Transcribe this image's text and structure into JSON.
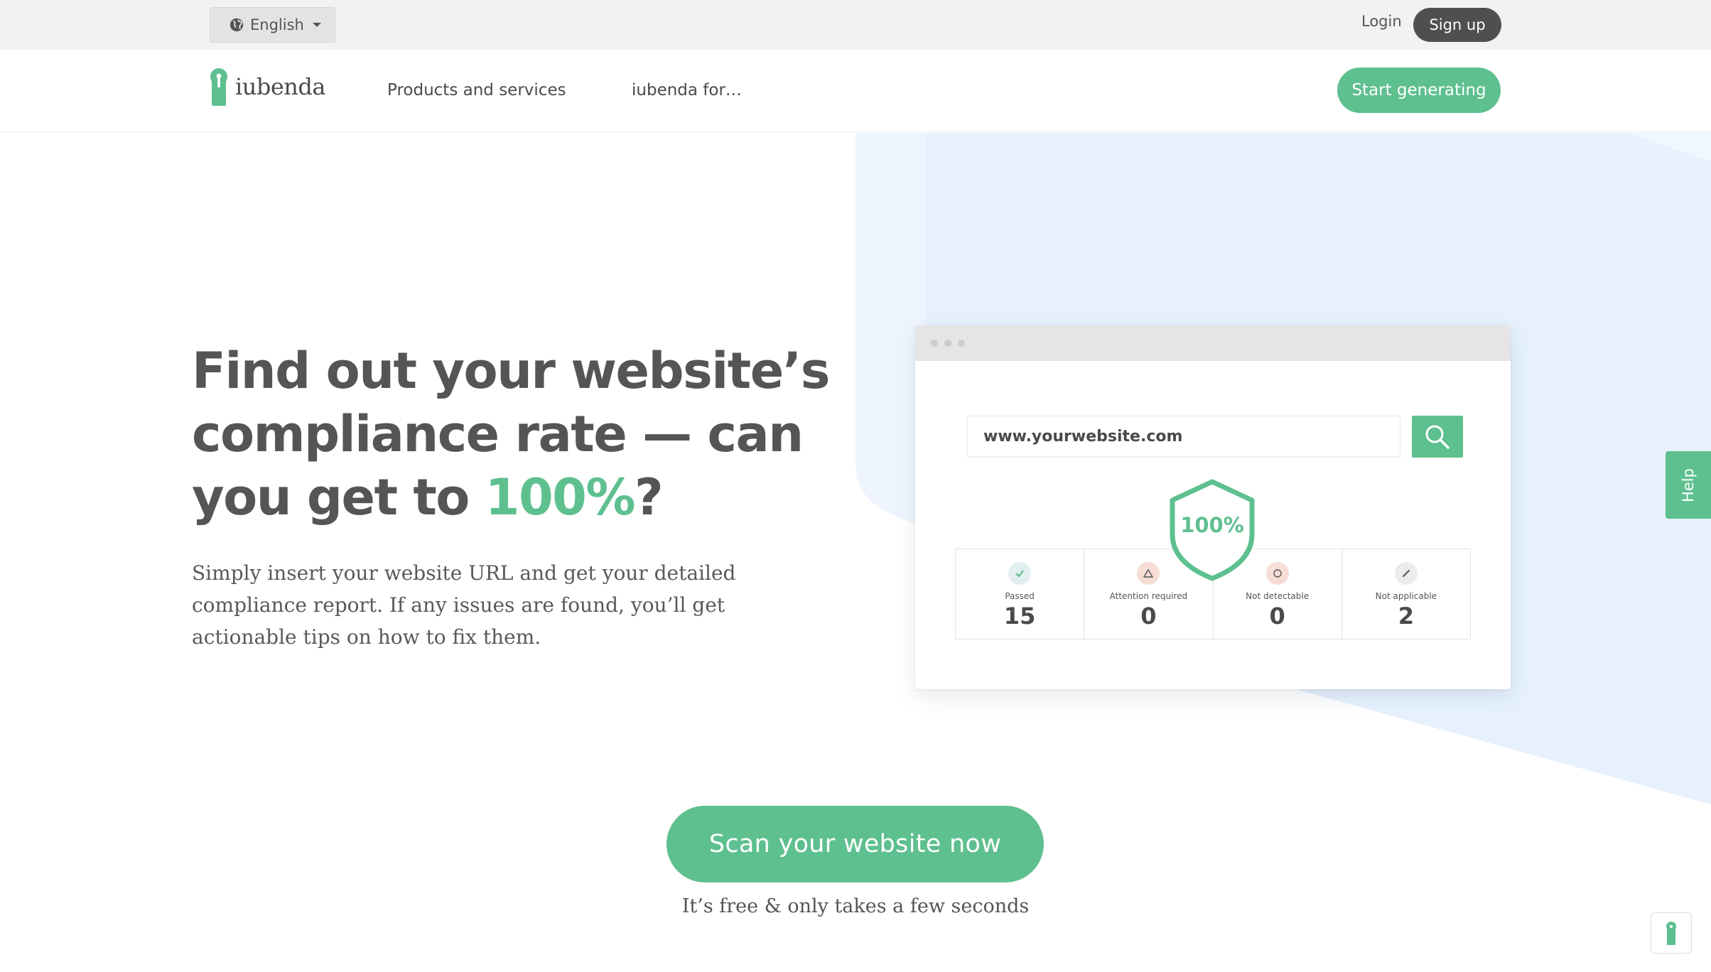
{
  "topbar": {
    "language": "English",
    "login": "Login",
    "signup": "Sign up"
  },
  "nav": {
    "logo_text": "iubenda",
    "items": [
      {
        "label": "Products and services"
      },
      {
        "label": "iubenda for…"
      }
    ],
    "cta": "Start generating"
  },
  "hero": {
    "headline_part1": "Find out your website’s compliance rate — can you get to ",
    "headline_accent": "100%",
    "headline_part2": "?",
    "subtext": "Simply insert your website URL and get your detailed compliance report. If any issues are found, you’ll get actionable tips on how to fix them."
  },
  "mockup": {
    "url_value": "www.yourwebsite.com",
    "score": "100%",
    "stats": [
      {
        "label": "Passed",
        "value": "15",
        "icon": "check-icon"
      },
      {
        "label": "Attention required",
        "value": "0",
        "icon": "warning-icon"
      },
      {
        "label": "Not detectable",
        "value": "0",
        "icon": "circle-icon"
      },
      {
        "label": "Not applicable",
        "value": "2",
        "icon": "pencil-icon"
      }
    ]
  },
  "cta": {
    "button": "Scan your website now",
    "note": "It’s free & only takes a few seconds"
  },
  "help": {
    "label": "Help"
  },
  "colors": {
    "accent": "#5ec08f",
    "text": "#555555",
    "topbar_bg": "#f2f2f2",
    "hero_blue": "#e8f2fd"
  }
}
